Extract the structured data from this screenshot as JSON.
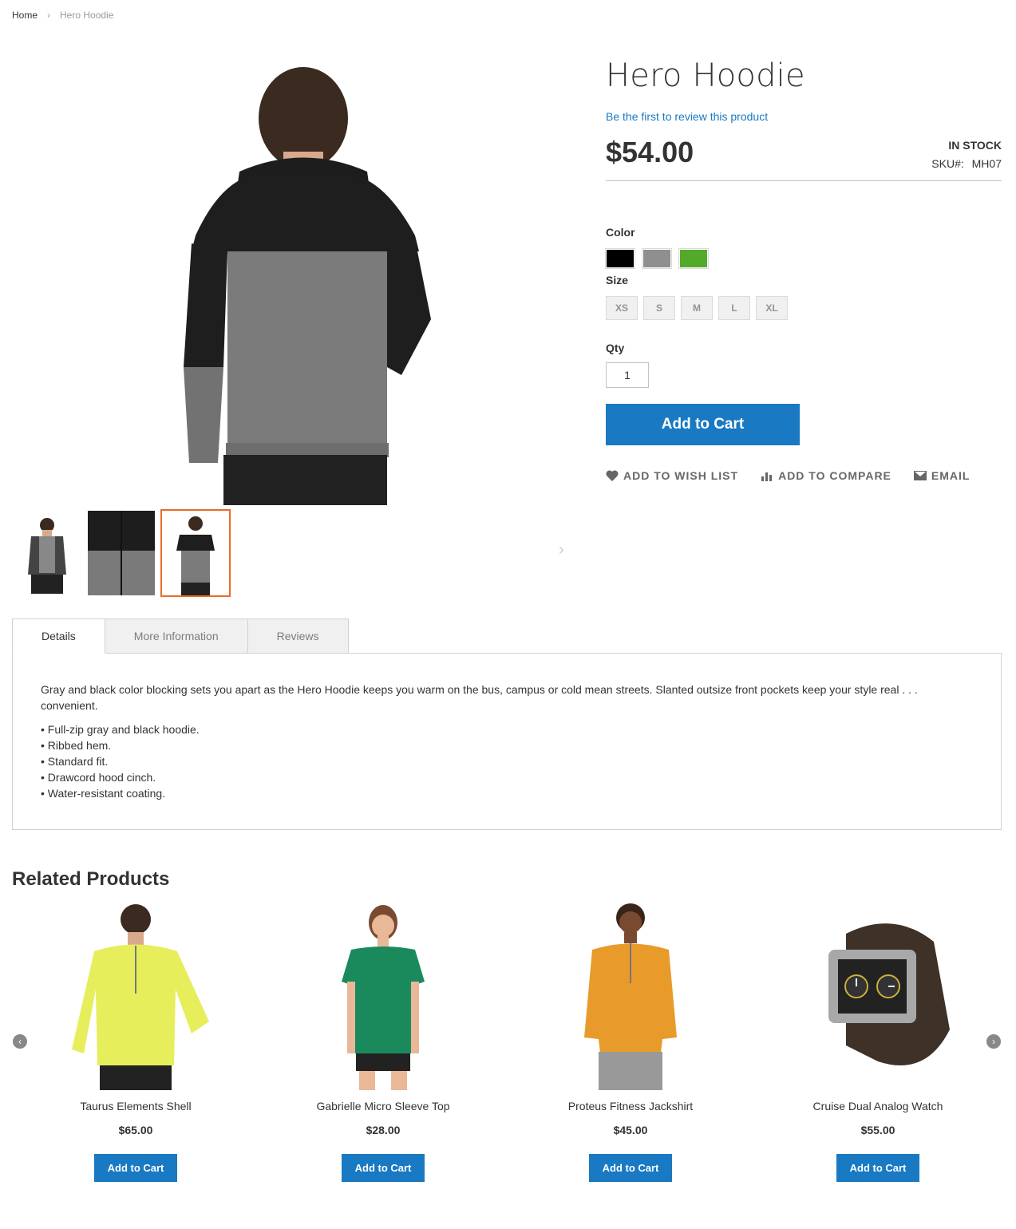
{
  "breadcrumb": {
    "home": "Home",
    "separator": "›",
    "current": "Hero Hoodie"
  },
  "product": {
    "title": "Hero Hoodie",
    "review_link": "Be the first to review this product",
    "price": "$54.00",
    "stock": "In stock",
    "sku_label": "SKU#:",
    "sku_value": "MH07"
  },
  "options": {
    "color_label": "Color",
    "colors": [
      "#000000",
      "#8f8f8f",
      "#53a929"
    ],
    "size_label": "Size",
    "sizes": [
      "XS",
      "S",
      "M",
      "L",
      "XL"
    ],
    "qty_label": "Qty",
    "qty_value": "1"
  },
  "buttons": {
    "add_to_cart": "Add to Cart"
  },
  "actions": {
    "wishlist": "Add to Wish List",
    "compare": "Add to Compare",
    "email": "Email"
  },
  "tabs": {
    "details": "Details",
    "more_info": "More Information",
    "reviews": "Reviews"
  },
  "details": {
    "description": "Gray and black color blocking sets you apart as the Hero Hoodie keeps you warm on the bus, campus or cold mean streets. Slanted outsize front pockets keep your style real . . . convenient.",
    "bullets": [
      "• Full-zip gray and black hoodie.",
      "• Ribbed hem.",
      "• Standard fit.",
      "• Drawcord hood cinch.",
      "• Water-resistant coating."
    ]
  },
  "related": {
    "title": "Related Products",
    "items": [
      {
        "name": "Taurus Elements Shell",
        "price": "$65.00",
        "button": "Add to Cart"
      },
      {
        "name": "Gabrielle Micro Sleeve Top",
        "price": "$28.00",
        "button": "Add to Cart"
      },
      {
        "name": "Proteus Fitness Jackshirt",
        "price": "$45.00",
        "button": "Add to Cart"
      },
      {
        "name": "Cruise Dual Analog Watch",
        "price": "$55.00",
        "button": "Add to Cart"
      }
    ]
  },
  "icons": {
    "breadcrumb_sep": "chevron-right-icon",
    "wishlist": "heart-icon",
    "compare": "compare-icon",
    "email": "envelope-icon",
    "gallery_next": "chevron-right-icon",
    "carousel_prev": "circle-arrow-left-icon",
    "carousel_next": "circle-arrow-right-icon"
  },
  "colors": {
    "accent": "#1979c3",
    "thumb_active": "#e86b29",
    "text": "#333333"
  }
}
